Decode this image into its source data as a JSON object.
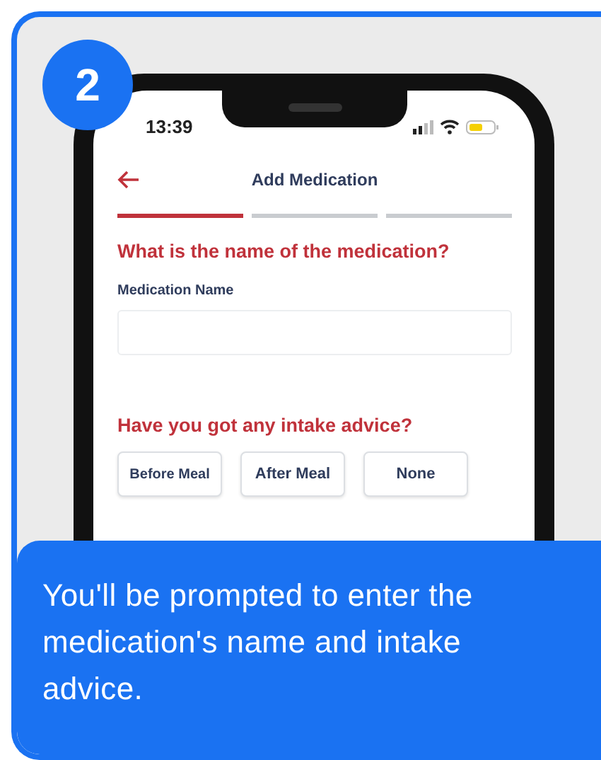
{
  "badge": "2",
  "phone": {
    "status_bar": {
      "time": "13:39"
    },
    "header": {
      "title": "Add Medication"
    },
    "steps": [
      {
        "selected": true
      },
      {
        "selected": false
      },
      {
        "selected": false
      }
    ],
    "name_question": "What is the name of the medication?",
    "name_field": {
      "label": "Medication Name"
    },
    "advice_question": "Have you got any intake advice?",
    "advice_options": [
      {
        "label": "Before Meal"
      },
      {
        "label": "After Meal"
      },
      {
        "label": "None"
      }
    ]
  },
  "caption": "You'll be prompted to enter the medication's name and intake advice."
}
